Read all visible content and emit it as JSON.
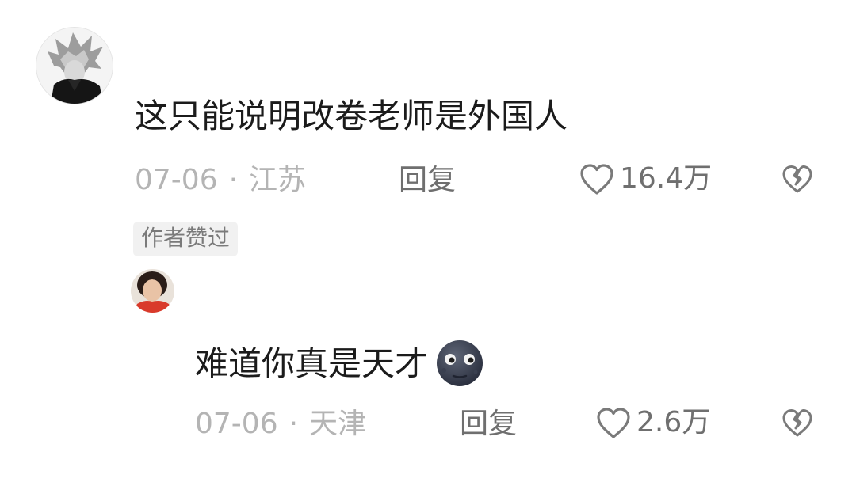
{
  "comments": [
    {
      "text": "这只能说明改卷老师是外国人",
      "date": "07-06",
      "location": "江苏",
      "reply_label": "回复",
      "likes": "16.4万",
      "badge": "作者赞过",
      "avatar_icon": "gray-haired-character-avatar"
    }
  ],
  "replies": [
    {
      "text": "难道你真是天才",
      "emoji": "new-moon-face",
      "date": "07-06",
      "location": "天津",
      "reply_label": "回复",
      "likes": "2.6万",
      "avatar_icon": "red-shirt-person-avatar"
    }
  ],
  "separator": "·",
  "icons": {
    "like": "heart-outline-icon",
    "dislike": "broken-heart-icon"
  },
  "colors": {
    "text": "#1b1b1b",
    "meta": "#b4b4b4",
    "action": "#6f6f6f",
    "badge_bg": "#f1f1f1"
  }
}
